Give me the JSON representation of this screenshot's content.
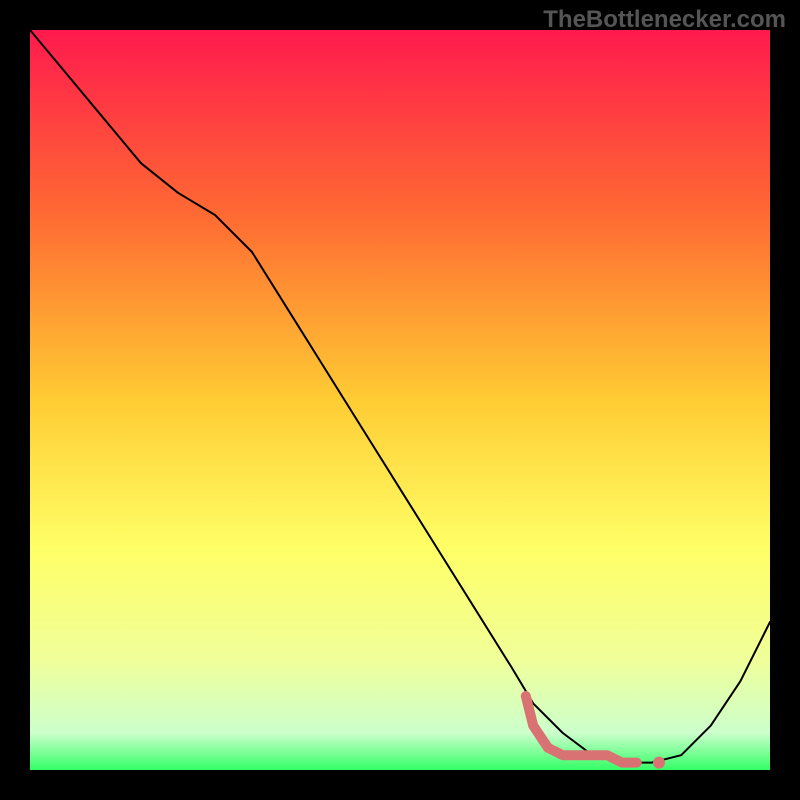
{
  "watermark": "TheBottlenecker.com",
  "chart_data": {
    "type": "line",
    "title": "",
    "xlabel": "",
    "ylabel": "",
    "xlim": [
      0,
      100
    ],
    "ylim": [
      0,
      100
    ],
    "background": {
      "type": "vertical_gradient",
      "stops": [
        {
          "offset": 0,
          "color": "#ff1a4d"
        },
        {
          "offset": 25,
          "color": "#ff6a33"
        },
        {
          "offset": 50,
          "color": "#ffcc33"
        },
        {
          "offset": 70,
          "color": "#ffff66"
        },
        {
          "offset": 85,
          "color": "#f0ff99"
        },
        {
          "offset": 95,
          "color": "#ccffcc"
        },
        {
          "offset": 100,
          "color": "#33ff66"
        }
      ]
    },
    "series": [
      {
        "name": "curve",
        "type": "line",
        "color": "#000000",
        "stroke_width": 2,
        "x": [
          0,
          5,
          10,
          15,
          20,
          25,
          30,
          35,
          40,
          45,
          50,
          55,
          60,
          65,
          68,
          72,
          76,
          80,
          84,
          88,
          92,
          96,
          100
        ],
        "y": [
          100,
          94,
          88,
          82,
          78,
          75,
          70,
          62,
          54,
          46,
          38,
          30,
          22,
          14,
          9,
          5,
          2,
          1,
          1,
          2,
          6,
          12,
          20
        ]
      },
      {
        "name": "highlight",
        "type": "line",
        "color": "#d97373",
        "stroke_width": 10,
        "x": [
          67,
          68,
          70,
          72,
          74,
          76,
          78,
          80,
          82
        ],
        "y": [
          10,
          6,
          3,
          2,
          2,
          2,
          2,
          1,
          1
        ]
      },
      {
        "name": "highlight-dot",
        "type": "scatter",
        "color": "#d97373",
        "radius": 6,
        "x": [
          85
        ],
        "y": [
          1
        ]
      }
    ]
  }
}
